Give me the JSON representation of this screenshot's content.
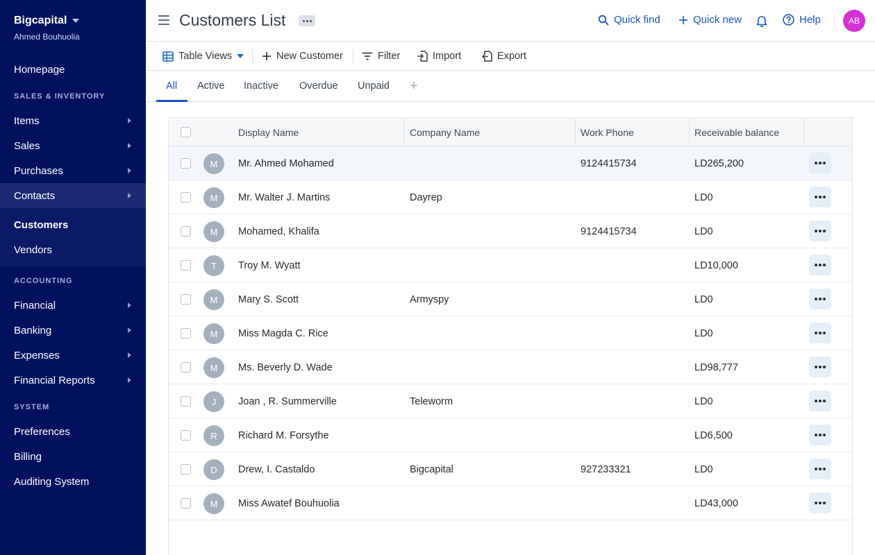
{
  "brand": {
    "name": "Bigcapital",
    "user": "Ahmed Bouhuolia"
  },
  "sidebar": {
    "homepage": "Homepage",
    "sections": [
      {
        "title": "SALES & INVENTORY"
      },
      {
        "title": "ACCOUNTING"
      },
      {
        "title": "SYSTEM"
      }
    ],
    "items": {
      "items": "Items",
      "sales": "Sales",
      "purchases": "Purchases",
      "contacts": "Contacts",
      "customers": "Customers",
      "vendors": "Vendors",
      "financial": "Financial",
      "banking": "Banking",
      "expenses": "Expenses",
      "financial_reports": "Financial Reports",
      "preferences": "Preferences",
      "billing": "Billing",
      "auditing": "Auditing System"
    }
  },
  "header": {
    "title": "Customers List",
    "quick_find": "Quick find",
    "quick_new": "Quick new",
    "help": "Help",
    "avatar_initials": "AB",
    "avatar_color": "#d432d6"
  },
  "toolbar": {
    "table_views": "Table Views",
    "new_customer": "New Customer",
    "filter": "Filter",
    "import": "Import",
    "export": "Export"
  },
  "tabs": [
    "All",
    "Active",
    "Inactive",
    "Overdue",
    "Unpaid"
  ],
  "table": {
    "columns": [
      "Display Name",
      "Company Name",
      "Work Phone",
      "Receivable balance"
    ],
    "rows": [
      {
        "initial": "M",
        "name": "Mr. Ahmed Mohamed",
        "company": "",
        "phone": "9124415734",
        "balance": "LD265,200"
      },
      {
        "initial": "M",
        "name": "Mr. Walter J. Martins",
        "company": "Dayrep",
        "phone": "",
        "balance": "LD0"
      },
      {
        "initial": "M",
        "name": "Mohamed, Khalifa",
        "company": "",
        "phone": "9124415734",
        "balance": "LD0"
      },
      {
        "initial": "T",
        "name": "Troy M. Wyatt",
        "company": "",
        "phone": "",
        "balance": "LD10,000"
      },
      {
        "initial": "M",
        "name": "Mary S. Scott",
        "company": "Armyspy",
        "phone": "",
        "balance": "LD0"
      },
      {
        "initial": "M",
        "name": "Miss Magda C. Rice",
        "company": "",
        "phone": "",
        "balance": "LD0"
      },
      {
        "initial": "M",
        "name": "Ms. Beverly D. Wade",
        "company": "",
        "phone": "",
        "balance": "LD98,777"
      },
      {
        "initial": "J",
        "name": "Joan , R. Summerville",
        "company": "Teleworm",
        "phone": "",
        "balance": "LD0"
      },
      {
        "initial": "R",
        "name": "Richard M. Forsythe",
        "company": "",
        "phone": "",
        "balance": "LD6,500"
      },
      {
        "initial": "D",
        "name": "Drew, I. Castaldo",
        "company": "Bigcapital",
        "phone": "927233321",
        "balance": "LD0"
      },
      {
        "initial": "M",
        "name": "Miss Awatef Bouhuolia",
        "company": "",
        "phone": "",
        "balance": "LD43,000"
      }
    ]
  },
  "colors": {
    "sidebar_bg": "#01115e",
    "accent": "#1c4fc5"
  }
}
